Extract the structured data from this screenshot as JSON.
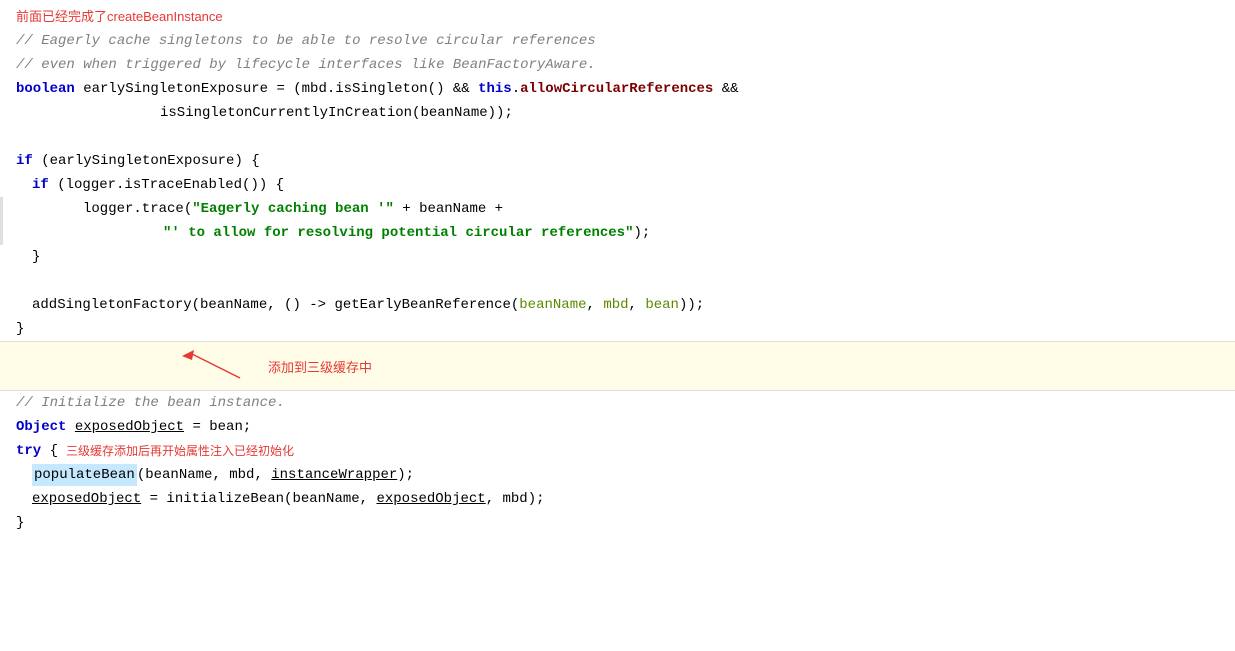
{
  "top_annotation": "前面已经完成了createBeanInstance",
  "code_lines": [
    {
      "id": "comment1",
      "indent": 0,
      "type": "comment",
      "text": "// Eagerly cache singletons to be able to resolve circular references"
    },
    {
      "id": "comment2",
      "indent": 0,
      "type": "comment",
      "text": "// even when triggered by lifecycle interfaces like BeanFactoryAware."
    },
    {
      "id": "bool_decl",
      "indent": 0,
      "type": "code"
    },
    {
      "id": "bool_cont",
      "indent": 1,
      "type": "code"
    },
    {
      "id": "blank1",
      "indent": 0,
      "type": "blank"
    },
    {
      "id": "if1",
      "indent": 0,
      "type": "code"
    },
    {
      "id": "if2",
      "indent": 1,
      "type": "code"
    },
    {
      "id": "logger_trace1",
      "indent": 2,
      "type": "code"
    },
    {
      "id": "logger_trace2",
      "indent": 3,
      "type": "code"
    },
    {
      "id": "close_if2",
      "indent": 1,
      "type": "code"
    },
    {
      "id": "blank2",
      "indent": 0,
      "type": "blank"
    },
    {
      "id": "addSingleton",
      "indent": 1,
      "type": "code"
    },
    {
      "id": "close_if1",
      "indent": 0,
      "type": "code"
    }
  ],
  "annotation_area": {
    "text": "添加到三级缓存中"
  },
  "bottom_code": [
    {
      "id": "comment_init",
      "text": "// Initialize the bean instance."
    },
    {
      "id": "object_decl",
      "text": "Object exposedObject = bean;"
    },
    {
      "id": "try_open",
      "text": "try {"
    },
    {
      "id": "populate",
      "text": ""
    },
    {
      "id": "exposed_init",
      "text": ""
    },
    {
      "id": "close_try",
      "text": "}"
    }
  ],
  "bottom_annotation": "三级缓存添加后再开始属性注入已经初始化"
}
